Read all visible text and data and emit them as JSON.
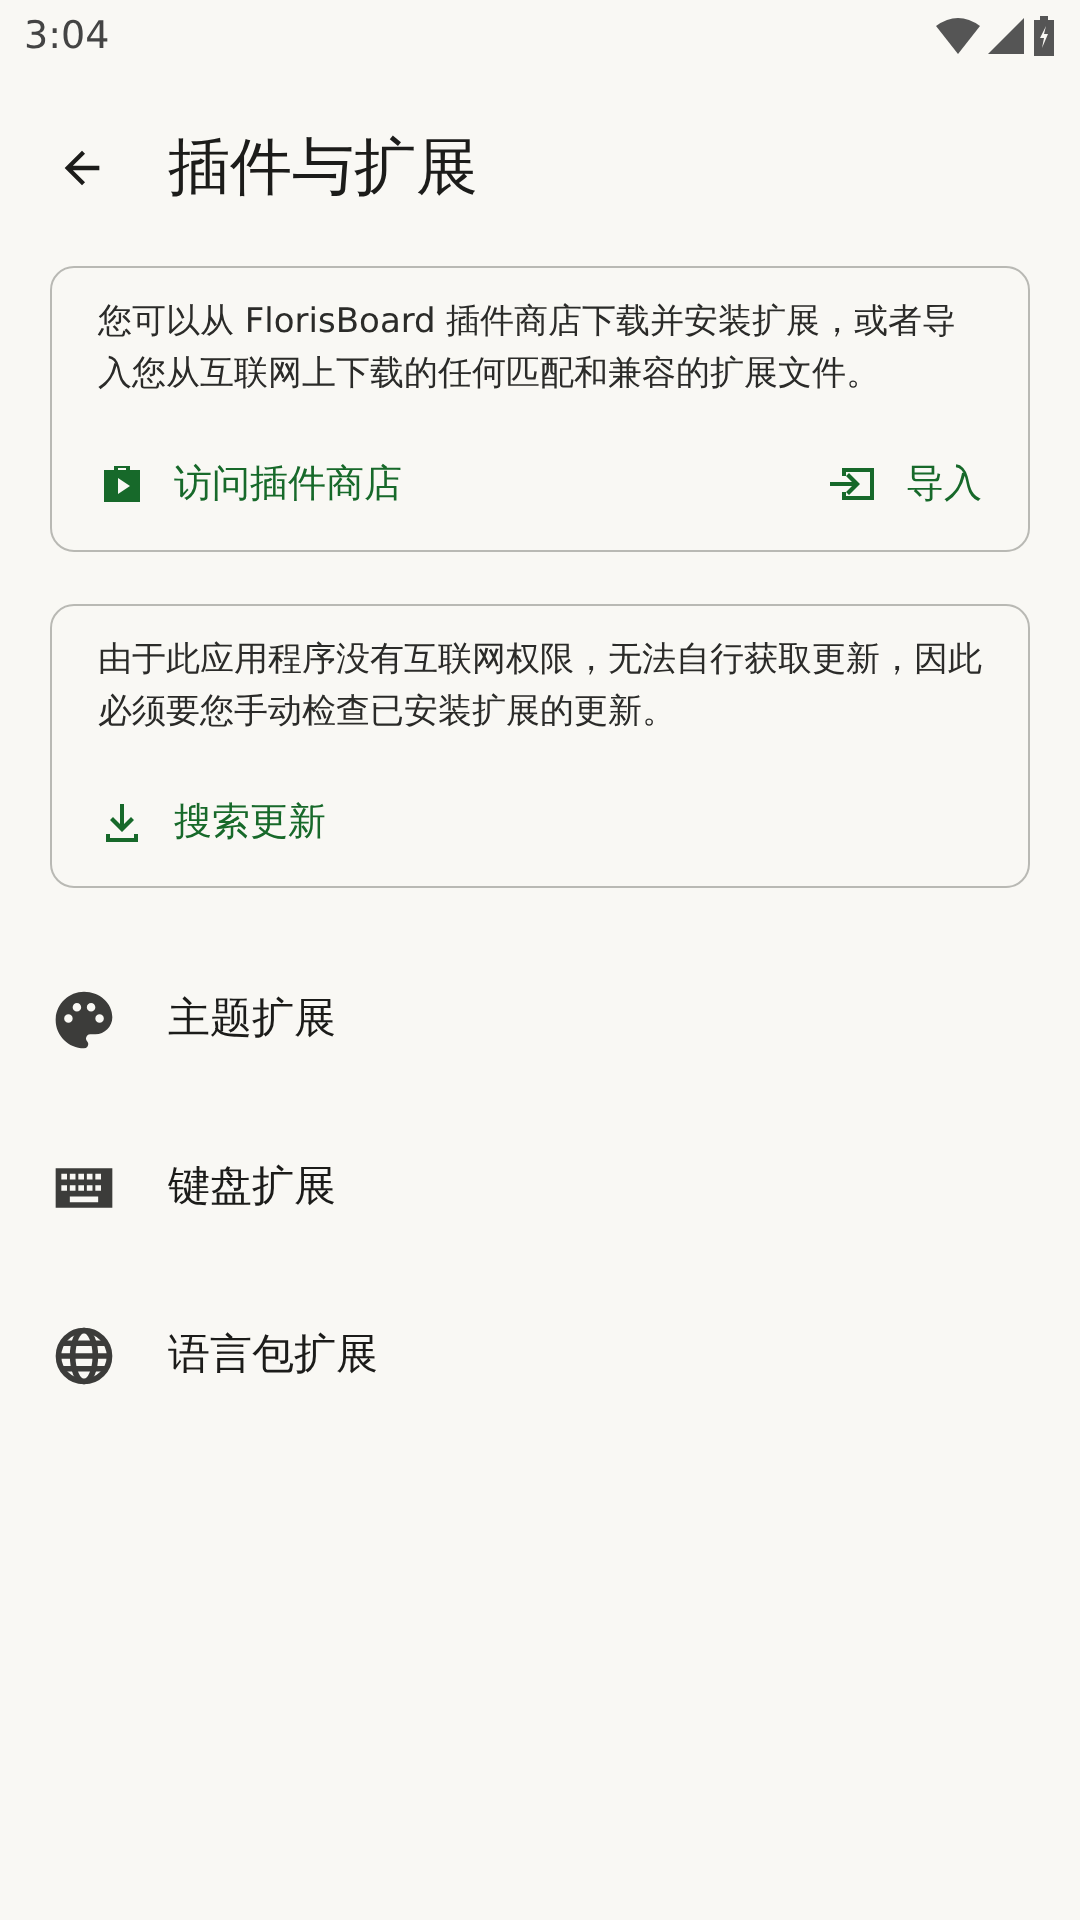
{
  "status_bar": {
    "time": "3:04"
  },
  "header": {
    "title": "插件与扩展"
  },
  "cards": [
    {
      "text": "您可以从 FlorisBoard 插件商店下载并安装扩展，或者导入您从互联网上下载的任何匹配和兼容的扩展文件。",
      "actions": [
        {
          "label": "访问插件商店"
        },
        {
          "label": "导入"
        }
      ]
    },
    {
      "text": "由于此应用程序没有互联网权限，无法自行获取更新，因此必须要您手动检查已安装扩展的更新。",
      "actions": [
        {
          "label": "搜索更新"
        }
      ]
    }
  ],
  "items": [
    {
      "label": "主题扩展"
    },
    {
      "label": "键盘扩展"
    },
    {
      "label": "语言包扩展"
    }
  ]
}
